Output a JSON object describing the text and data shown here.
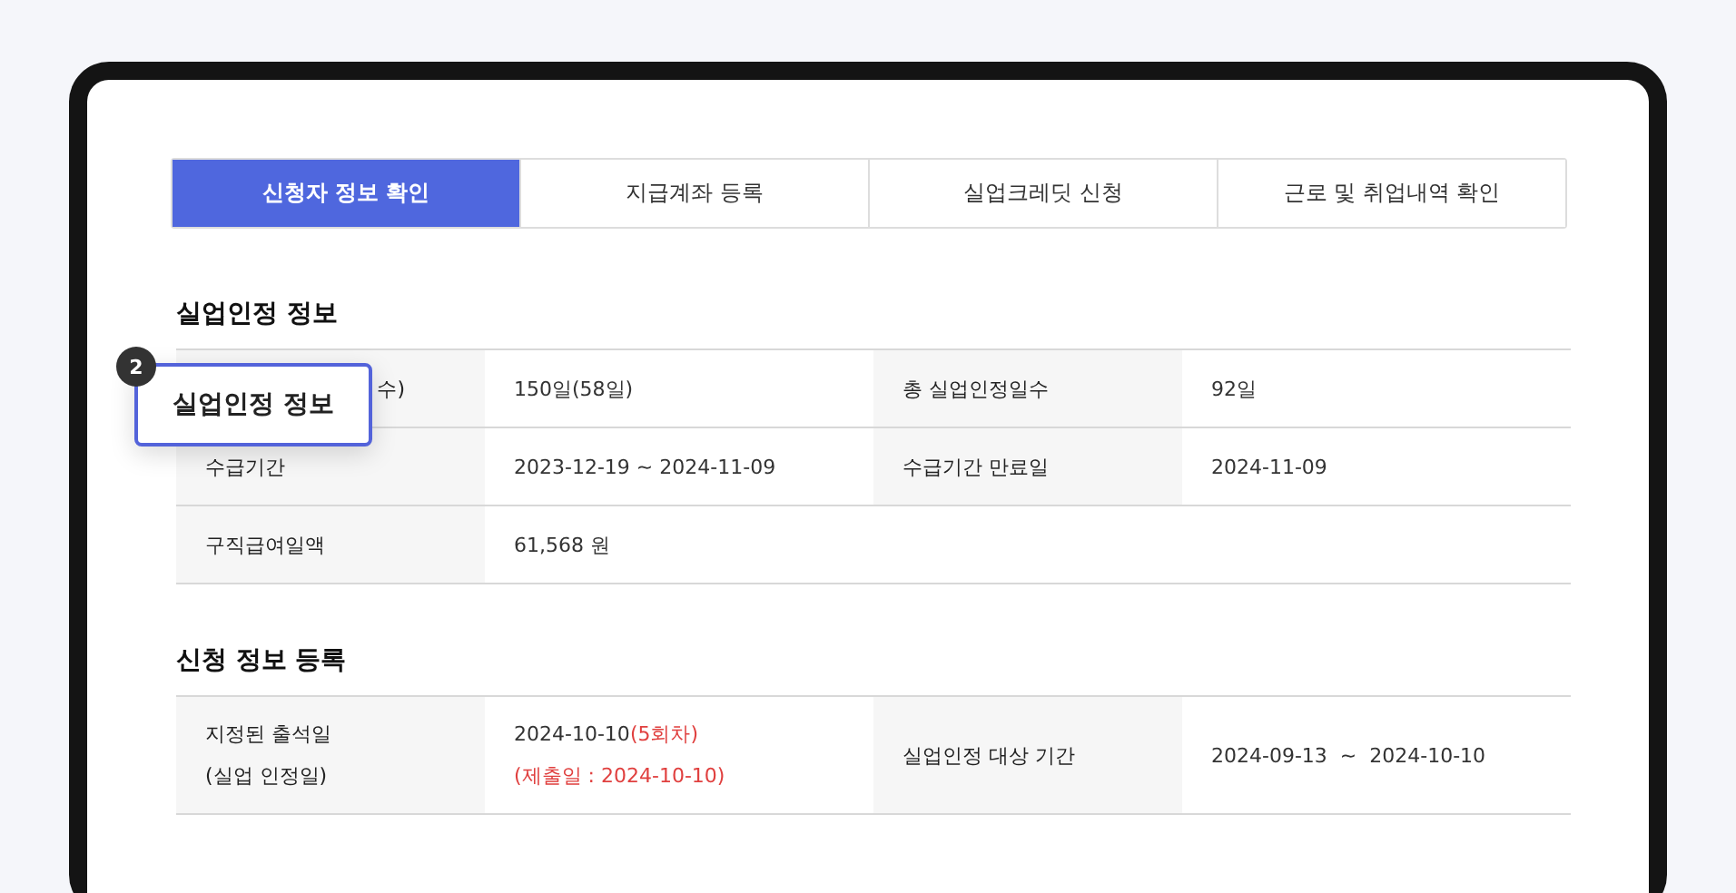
{
  "tabs": [
    {
      "label": "신청자 정보 확인",
      "selected": true
    },
    {
      "label": "지급계좌 등록",
      "selected": false
    },
    {
      "label": "실업크레딧 신청",
      "selected": false
    },
    {
      "label": "근로 및 취업내역 확인",
      "selected": false
    }
  ],
  "info": {
    "title": "실업인정 정보",
    "rows": [
      [
        {
          "label": "수)",
          "obscured": true,
          "value": "150일(58일)"
        },
        {
          "label": "총 실업인정일수",
          "obscured": false,
          "value": "92일"
        }
      ],
      [
        {
          "label": "수급기간",
          "obscured": false,
          "value": "2023-12-19 ~ 2024-11-09"
        },
        {
          "label": "수급기간 만료일",
          "obscured": false,
          "value": "2024-11-09"
        }
      ],
      [
        {
          "label": "구직급여일액",
          "obscured": false,
          "value": "61,568 원"
        }
      ]
    ]
  },
  "callout": {
    "badge": "2",
    "text": "실업인정 정보"
  },
  "apply": {
    "title": "신청 정보 등록",
    "label_lines": [
      "지정된 출석일",
      "(실업 인정일)"
    ],
    "date": "2024-10-10",
    "round": "(5회차)",
    "submitted": "(제출일 : 2024-10-10)",
    "period_label": "실업인정 대상 기간",
    "period": "2024-09-13  ~  2024-10-10"
  }
}
